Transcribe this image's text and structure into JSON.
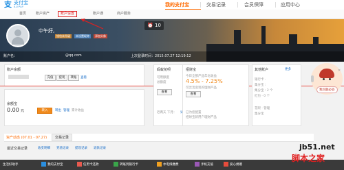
{
  "header": {
    "logo_mark": "支",
    "logo_text": "支付宝",
    "logo_sub": "ALIPAY",
    "nav": [
      "我的支付宝",
      "交易记录",
      "会员保障",
      "应用中心"
    ]
  },
  "subnav": [
    "首页",
    "账户资产",
    "账户设置",
    "账户通",
    "商户服务"
  ],
  "banner": {
    "greeting": "中午好,",
    "tags": [
      "钱包未升级",
      "未设置昵称",
      "添加头像"
    ],
    "account_prefix": "账户名：",
    "account_domain": "@qq.com",
    "last_login": "上次登录时间：2015.07.27 12:19:12",
    "timer": "10"
  },
  "balance": {
    "title": "账户余额",
    "buttons": [
      "充值",
      "提现",
      "转账"
    ],
    "link": "查看"
  },
  "yuebao": {
    "title": "余额宝",
    "amount": "0.00",
    "unit": "元",
    "transfer_in": "转入",
    "links": [
      "转出",
      "管理",
      "累计收益"
    ]
  },
  "huabei": {
    "title": "蚂蚁花呗",
    "lines": [
      "可用额度",
      "总额度"
    ],
    "button": "查看",
    "footer": "近两天 下月：",
    "footer_link": "详情"
  },
  "zhaocaibao": {
    "title": "招财宝",
    "desc": "今日全部产品年化收益",
    "rate": "4.5% - 7.25%",
    "note": "可灵活变现的理财产品",
    "button": "查看",
    "footer": "已为您配置",
    "footer2": "招财宝新用户理财产品"
  },
  "other_accounts": {
    "title": "其他账户",
    "more": "更多",
    "items": [
      "银行卡 ·",
      "集分宝 :",
      "集分宝 : 2 个",
      "红包 · 0 个",
      "花呗 · 管理",
      "集分宝"
    ]
  },
  "side": {
    "bubble": "我问题必答",
    "close": "✕"
  },
  "tabs": {
    "records": "资产动态 (07.01 - 07.27)",
    "records2": "交易记录",
    "sublabel": "最近交易记录",
    "sublinks": [
      "收支明细",
      "充值记录",
      "提现记录",
      "退款记录"
    ]
  },
  "bottombar": {
    "start": "生活好助手",
    "items": [
      "我的支付宝",
      "信用卡还款",
      "转账到银行卡",
      "水电煤缴费",
      "手机充值",
      "爱心捐赠"
    ]
  },
  "watermark": {
    "line1": "jb51.net",
    "line2": "脚本之家"
  },
  "colors": {
    "brand": "#1a8be0",
    "accent": "#ff6a00",
    "highlight": "#e02020"
  }
}
